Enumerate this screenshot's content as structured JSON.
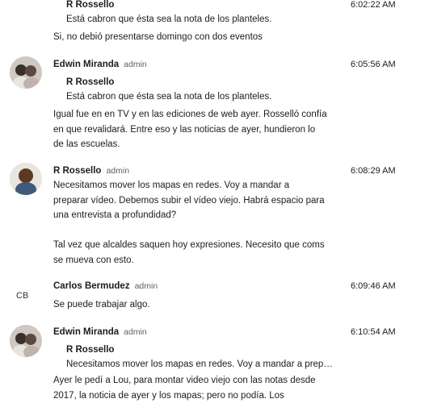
{
  "messages": [
    {
      "quote_author": "R Rossello",
      "quote_text": "Está cabron que ésta sea la nota de los planteles.",
      "time": "6:02:22 AM",
      "body": "Si, no debió presentarse domingo con dos eventos"
    },
    {
      "author": "Edwin Miranda",
      "role": "admin",
      "time": "6:05:56 AM",
      "quote_author": "R Rossello",
      "quote_text": "Está cabron que ésta sea la nota de los planteles.",
      "body_lines": [
        "Igual fue en en TV y en las ediciones de web ayer. Rosselló confía",
        "en que revalidará. Entre eso y las noticias de ayer, hundieron lo",
        "de las escuelas."
      ]
    },
    {
      "author": "R Rossello",
      "role": "admin",
      "time": "6:08:29 AM",
      "body_lines": [
        "Necesitamos mover los mapas en redes.  Voy a mandar a",
        "preparar vídeo. Debemos subir el vídeo viejo.  Habrá espacio para",
        "una entrevista a profundidad?"
      ],
      "body_lines_2": [
        "Tal vez que alcaldes saquen hoy expresiones.  Necesito que coms",
        "se mueva con esto."
      ]
    },
    {
      "author": "Carlos Bermudez",
      "role": "admin",
      "initials": "CB",
      "time": "6:09:46 AM",
      "body": "Se puede trabajar algo."
    },
    {
      "author": "Edwin Miranda",
      "role": "admin",
      "time": "6:10:54 AM",
      "quote_author": "R Rossello",
      "quote_text": "Necesitamos mover los mapas en redes. Voy a mandar a prep…",
      "body_lines": [
        "Ayer le pedí a Lou, para montar video viejo con las notas desde",
        "2017, la noticia de ayer y los mapas; pero no podía. Los"
      ]
    }
  ]
}
